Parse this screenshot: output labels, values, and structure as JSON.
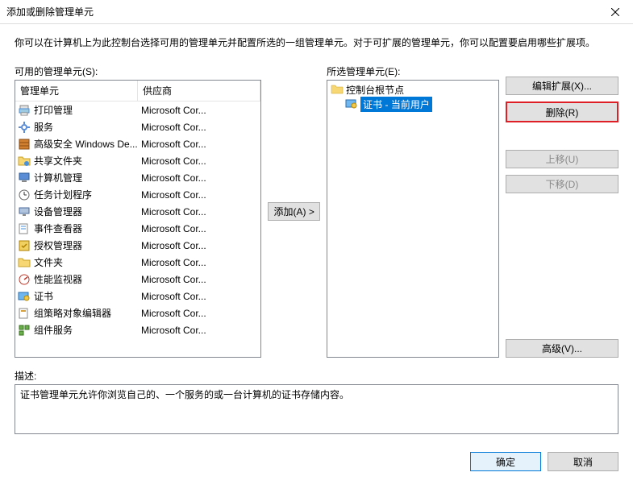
{
  "title": "添加或删除管理单元",
  "intro": "你可以在计算机上为此控制台选择可用的管理单元并配置所选的一组管理单元。对于可扩展的管理单元，你可以配置要启用哪些扩展项。",
  "available_label": "可用的管理单元(S):",
  "selected_label": "所选管理单元(E):",
  "desc_label": "描述:",
  "columns": {
    "snapin": "管理单元",
    "vendor": "供应商"
  },
  "available": [
    {
      "name": "打印管理",
      "vendor": "Microsoft Cor...",
      "icon": "printer-icon"
    },
    {
      "name": "服务",
      "vendor": "Microsoft Cor...",
      "icon": "gear-icon"
    },
    {
      "name": "高级安全 Windows De...",
      "vendor": "Microsoft Cor...",
      "icon": "firewall-icon"
    },
    {
      "name": "共享文件夹",
      "vendor": "Microsoft Cor...",
      "icon": "share-folder-icon"
    },
    {
      "name": "计算机管理",
      "vendor": "Microsoft Cor...",
      "icon": "computer-icon"
    },
    {
      "name": "任务计划程序",
      "vendor": "Microsoft Cor...",
      "icon": "clock-icon"
    },
    {
      "name": "设备管理器",
      "vendor": "Microsoft Cor...",
      "icon": "device-icon"
    },
    {
      "name": "事件查看器",
      "vendor": "Microsoft Cor...",
      "icon": "event-icon"
    },
    {
      "name": "授权管理器",
      "vendor": "Microsoft Cor...",
      "icon": "auth-icon"
    },
    {
      "name": "文件夹",
      "vendor": "Microsoft Cor...",
      "icon": "folder-icon"
    },
    {
      "name": "性能监视器",
      "vendor": "Microsoft Cor...",
      "icon": "perf-icon"
    },
    {
      "name": "证书",
      "vendor": "Microsoft Cor...",
      "icon": "cert-icon"
    },
    {
      "name": "组策略对象编辑器",
      "vendor": "Microsoft Cor...",
      "icon": "gpo-icon"
    },
    {
      "name": "组件服务",
      "vendor": "Microsoft Cor...",
      "icon": "component-icon"
    }
  ],
  "tree": {
    "root": "控制台根节点",
    "child": "证书 - 当前用户"
  },
  "buttons": {
    "add": "添加(A) >",
    "edit_ext": "编辑扩展(X)...",
    "remove": "删除(R)",
    "move_up": "上移(U)",
    "move_down": "下移(D)",
    "advanced": "高级(V)...",
    "ok": "确定",
    "cancel": "取消"
  },
  "description": "证书管理单元允许你浏览自己的、一个服务的或一台计算机的证书存储内容。"
}
